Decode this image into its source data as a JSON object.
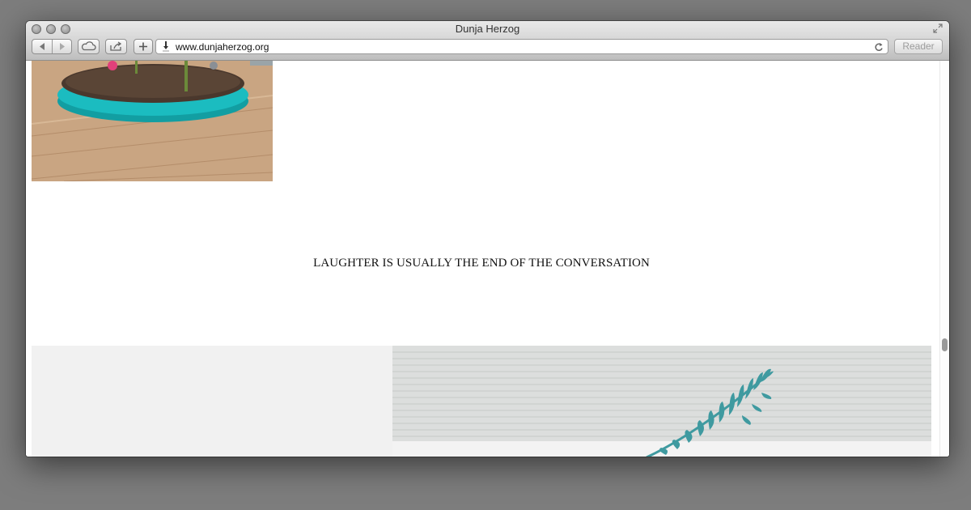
{
  "window": {
    "title": "Dunja Herzog"
  },
  "toolbar": {
    "url": "www.dunjaherzog.org",
    "reader_label": "Reader",
    "back_icon": "back-arrow-icon",
    "forward_icon": "forward-arrow-icon",
    "icloud_icon": "cloud-icon",
    "share_icon": "share-icon",
    "new_tab_icon": "plus-icon",
    "reload_icon": "reload-icon"
  },
  "page": {
    "headline": "LAUGHTER IS USUALLY THE END OF THE CONVERSATION"
  },
  "colors": {
    "turquoise": "#1bbcc0",
    "soil": "#4a382d",
    "wood_floor": "#c9a582",
    "leaf": "#3f9aa0"
  }
}
